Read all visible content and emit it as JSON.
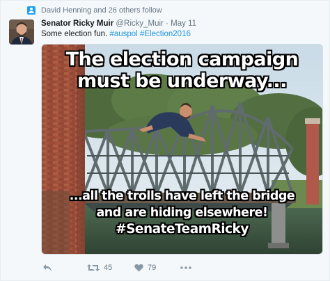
{
  "social_context": {
    "text": "David Henning and 26 others follow",
    "icon": "follow-icon"
  },
  "author": {
    "name": "Senator Ricky Muir",
    "handle": "@Ricky_Muir",
    "separator": "·",
    "time": "May 11"
  },
  "tweet": {
    "text_plain": "Some election fun. ",
    "hashtag1": "#auspol",
    "hashtag2": "#Election2016"
  },
  "media": {
    "top_line1": "The election campaign",
    "top_line2": "must be underway...",
    "bottom_line1": "...all the trolls have left the bridge",
    "bottom_line2": "and are hiding elsewhere!",
    "bottom_line3": "#SenateTeamRicky"
  },
  "actions": {
    "reply_icon": "reply-icon",
    "retweet_icon": "retweet-icon",
    "retweet_count": "45",
    "like_icon": "heart-icon",
    "like_count": "79",
    "more_icon": "more-icon"
  },
  "colors": {
    "link": "#1b95e0",
    "muted": "#657786",
    "background": "#f5f8fa"
  }
}
